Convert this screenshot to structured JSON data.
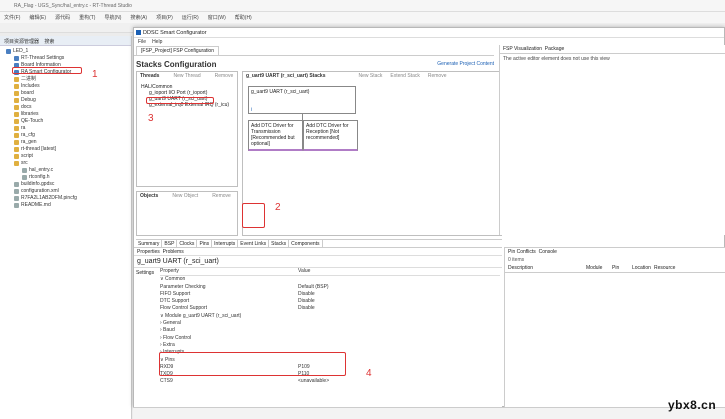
{
  "ide": {
    "title": "RA_Flag - UGS_Sync/hal_entry.c - RT-Thread Studio",
    "menu": [
      "文件(F)",
      "编辑(E)",
      "源代码",
      "重构(T)",
      "导航(N)",
      "搜索(A)",
      "项目(P)",
      "运行(R)",
      "窗口(W)",
      "帮助(H)"
    ]
  },
  "left": {
    "tab": "项目资源管理器",
    "tab2": "搜索",
    "tree": [
      "LED_1",
      "RT-Thread Settings",
      "Board Information",
      "RA Smart Configurator",
      "二进制",
      "Includes",
      "board",
      "Debug",
      "docs",
      "libraries",
      "QE-Touch",
      "ra",
      "ra_cfg",
      "ra_gen",
      "rt-thread [latest]",
      "script",
      "src",
      "hal_entry.c",
      "rtconfig.h",
      "buildinfo.gpdsc",
      "configuration.xml",
      "R7FA2L1AB2DFM.pincfg",
      "README.md"
    ]
  },
  "rasc": {
    "title": "DDSC Smart Configurator",
    "menu": [
      "File",
      "Help"
    ],
    "tab": "[FSP_Project] FSP Configuration",
    "heading": "Stacks Configuration",
    "generate": "Generate Project Content",
    "threads": {
      "label": "Threads",
      "new_thread": "New Thread",
      "remove": "Remove",
      "items": [
        "HAL/Common",
        "g_ioport I/O Port (r_ioport)",
        "g_uart9 UART (r_sci_uart)",
        "g_external_irq0 External IRQ (r_icu)"
      ]
    },
    "stacks_title": "g_uart9 UART (r_sci_uart) Stacks",
    "new_stack": "New Stack",
    "extend_stack": "Extend Stack",
    "remove_stack": "Remove",
    "module_main": "g_uart9 UART (r_sci_uart)",
    "module_info": "i",
    "module_tx": "Add DTC Driver for Transmission [Recommended but optional]",
    "module_rx": "Add DTC Driver for Reception [Not recommended]",
    "objects": {
      "label": "Objects",
      "new_object": "New Object",
      "remove": "Remove"
    },
    "bottom_tabs": [
      "Summary",
      "BSP",
      "Clocks",
      "Pins",
      "Interrupts",
      "Event Links",
      "Stacks",
      "Components"
    ],
    "annot": {
      "n1": "1",
      "n2": "2",
      "n3": "3",
      "n4": "4"
    }
  },
  "right_top": {
    "tab1": "FSP Visualization",
    "tab2": "Package",
    "msg": "The active editor element does not use this view"
  },
  "properties": {
    "tabs": [
      "Properties",
      "Problems"
    ],
    "title": "g_uart9 UART (r_sci_uart)",
    "side": "Settings",
    "col_prop": "Property",
    "col_val": "Value",
    "rows": [
      {
        "k": "∨ Common",
        "v": ""
      },
      {
        "k": "      Parameter Checking",
        "v": "Default (BSP)"
      },
      {
        "k": "      FIFO Support",
        "v": "Disable"
      },
      {
        "k": "      DTC Support",
        "v": "Disable"
      },
      {
        "k": "      Flow Control Support",
        "v": "Disable"
      },
      {
        "k": "∨ Module g_uart9 UART (r_sci_uart)",
        "v": ""
      },
      {
        "k": "   › General",
        "v": ""
      },
      {
        "k": "   › Baud",
        "v": ""
      },
      {
        "k": "   › Flow Control",
        "v": ""
      },
      {
        "k": "   › Extra",
        "v": ""
      },
      {
        "k": "   › Interrupts",
        "v": ""
      },
      {
        "k": "∨ Pins",
        "v": ""
      },
      {
        "k": "      RXD9",
        "v": "P109"
      },
      {
        "k": "      TXD9",
        "v": "P110"
      },
      {
        "k": "      CTS9",
        "v": "<unavailable>"
      }
    ]
  },
  "conflicts": {
    "tab1": "Pin Conflicts",
    "tab2": "Console",
    "items": "0 items",
    "cols": [
      "Description",
      "Module",
      "Pin",
      "Location",
      "Resource"
    ]
  },
  "watermark": "ybx8.cn"
}
